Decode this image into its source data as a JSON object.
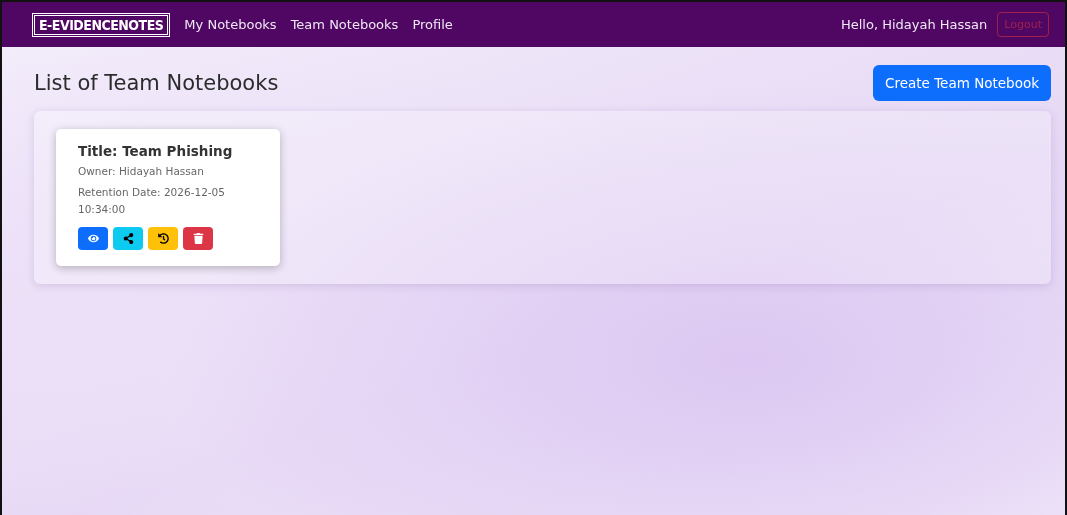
{
  "navbar": {
    "brand": "E-EVIDENCENOTES",
    "links": [
      {
        "label": "My Notebooks"
      },
      {
        "label": "Team Notebooks"
      },
      {
        "label": "Profile"
      }
    ],
    "greeting": "Hello, Hidayah Hassan",
    "logout": "Logout"
  },
  "heading": "List of Team Notebooks",
  "create_button": "Create Team Notebook",
  "notebooks": [
    {
      "title": "Title: Team Phishing",
      "owner": "Owner: Hidayah Hassan",
      "retention": "Retention Date: 2026-12-05 10:34:00",
      "actions": [
        {
          "kind": "view"
        },
        {
          "kind": "share"
        },
        {
          "kind": "history"
        },
        {
          "kind": "delete"
        }
      ]
    }
  ]
}
